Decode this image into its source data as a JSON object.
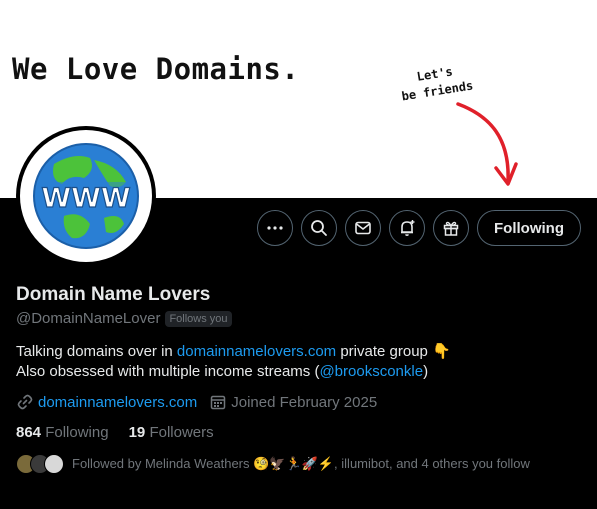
{
  "banner": {
    "title": "We Love Domains.",
    "note_line1": "Let's",
    "note_line2": "be friends"
  },
  "profile": {
    "name": "Domain Name Lovers",
    "handle": "@DomainNameLover",
    "follows_you": "Follows you",
    "bio_line1_prefix": "Talking domains over in ",
    "bio_line1_link": "domainnamelovers.com",
    "bio_line1_suffix": " private group 👇",
    "bio_line2_prefix": "Also obsessed with multiple income streams (",
    "bio_line2_mention": "@brooksconkle",
    "bio_line2_suffix": ")",
    "website": "domainnamelovers.com",
    "joined": "Joined February 2025",
    "following_count": "864",
    "following_label": "Following",
    "followers_count": "19",
    "followers_label": "Followers",
    "followed_by": "Followed by Melinda Weathers 🧐🦅🏃🚀⚡, illumibot, and 4 others you follow"
  },
  "actions": {
    "follow_button": "Following",
    "icons": [
      "more-icon",
      "search-icon",
      "message-icon",
      "notify-icon",
      "gift-icon"
    ]
  },
  "avatar_text": "WWW",
  "colors": {
    "accent": "#1d9bf0",
    "muted": "#71767b",
    "arrow": "#e0202a"
  }
}
